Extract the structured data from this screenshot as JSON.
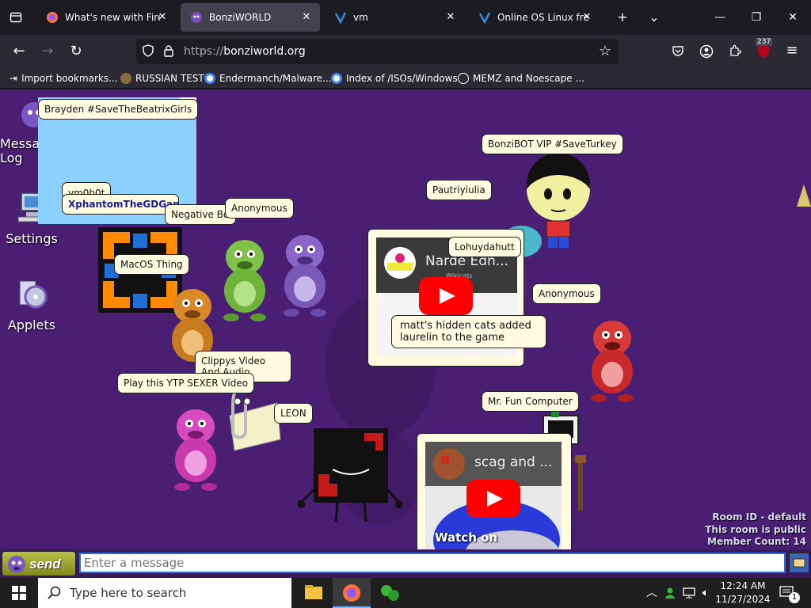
{
  "browser": {
    "tabs": [
      {
        "title": "What's new with Firefox",
        "active": false
      },
      {
        "title": "BonziWORLD",
        "active": true
      },
      {
        "title": "vm",
        "active": false
      },
      {
        "title": "Online OS Linux free w",
        "active": false
      }
    ],
    "new_tab": "+",
    "tab_list": "⌄",
    "window_controls": {
      "minimize": "—",
      "restore": "❐",
      "close": "✕"
    },
    "url_scheme": "https://",
    "url_host": "bonziworld.org",
    "extension_badge": "237",
    "bookmarks": [
      "Import bookmarks...",
      "RUSSIAN TEST",
      "Endermanch/Malware...",
      "Index of /ISOs/Windows",
      "MEMZ and Noescape ..."
    ]
  },
  "desktop_icons": [
    {
      "label": "Message Log"
    },
    {
      "label": "Settings"
    },
    {
      "label": "Applets"
    }
  ],
  "bubbles": [
    {
      "text": "Brayden #SaveTheBeatrixGirls"
    },
    {
      "text": "vm0b0t"
    },
    {
      "text": "XphantomTheGDGamer"
    },
    {
      "text": "Negative Boni"
    },
    {
      "text": "Anonymous"
    },
    {
      "text": "MacOS Thing"
    },
    {
      "text": "BonziBOT VIP #SaveTurkey"
    },
    {
      "text": "Pautriyiulia"
    },
    {
      "text": "Lohuydahutt"
    },
    {
      "text": "Anonymous"
    },
    {
      "text": "matt's hidden cats added laurelin to the game"
    },
    {
      "text": "Clippys Video And Audio"
    },
    {
      "text": "Play this YTP SEXER Video"
    },
    {
      "text": "LEON"
    },
    {
      "text": "Mr. Fun Computer"
    }
  ],
  "videos": [
    {
      "title": "Narde Edn...",
      "subtitle": "Wikicats"
    },
    {
      "title": "scag and ...",
      "cta": "Watch on"
    }
  ],
  "room": {
    "id_line": "Room ID - default",
    "public_line": "This room is public",
    "count_line": "Member Count: 14"
  },
  "chat": {
    "send_label": "send",
    "placeholder": "Enter a message"
  },
  "taskbar": {
    "search_placeholder": "Type here to search",
    "time": "12:24 AM",
    "date": "11/27/2024",
    "notifications": "1"
  },
  "colors": {
    "page_bg": "#4a1f73",
    "bubble_bg": "#fffbe0",
    "browser_chrome": "#2b2a33",
    "youtube_red": "#ff0000"
  }
}
